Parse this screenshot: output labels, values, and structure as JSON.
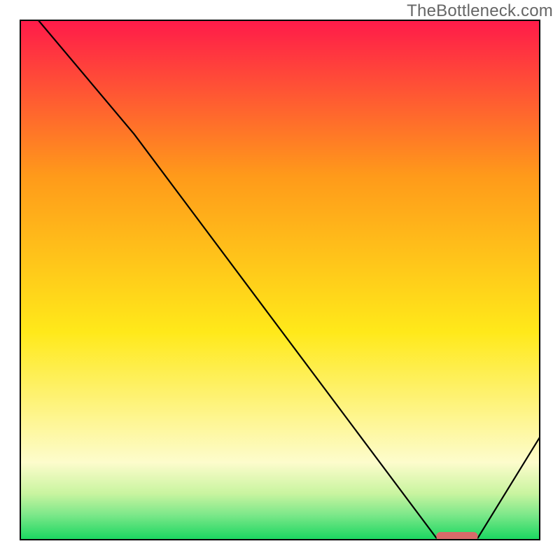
{
  "watermark": "TheBottleneck.com",
  "colors": {
    "red": "#ff1a4a",
    "orange": "#ff9a1a",
    "yellow": "#ffe91a",
    "paleYellow": "#fdfccc",
    "limeStart": "#c9f4a0",
    "limeMid": "#7ee88a",
    "green": "#16d65f",
    "line": "#000000",
    "marker": "#d96a6a",
    "axis": "#000000"
  },
  "chart_data": {
    "type": "line",
    "title": "",
    "xlabel": "",
    "ylabel": "",
    "xlim": [
      0,
      100
    ],
    "ylim": [
      0,
      100
    ],
    "x": [
      0,
      3.5,
      22,
      80,
      82,
      88,
      100
    ],
    "y": [
      102,
      100,
      78,
      0.5,
      0.5,
      0.5,
      20
    ],
    "marker": {
      "x_start": 80,
      "x_end": 88,
      "y": 0.8
    },
    "gradient_stops": [
      {
        "pct": 0,
        "color_key": "red"
      },
      {
        "pct": 30,
        "color_key": "orange"
      },
      {
        "pct": 60,
        "color_key": "yellow"
      },
      {
        "pct": 85,
        "color_key": "paleYellow"
      },
      {
        "pct": 91,
        "color_key": "limeStart"
      },
      {
        "pct": 95,
        "color_key": "limeMid"
      },
      {
        "pct": 100,
        "color_key": "green"
      }
    ],
    "grid": false,
    "legend": false
  }
}
